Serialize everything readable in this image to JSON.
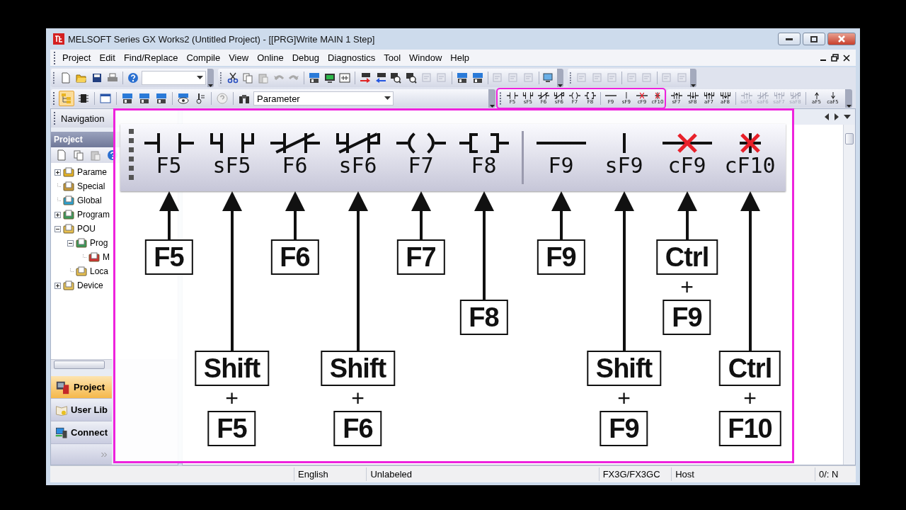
{
  "window": {
    "title": "MELSOFT Series GX Works2 (Untitled Project) - [[PRG]Write MAIN 1 Step]"
  },
  "menu": [
    "Project",
    "Edit",
    "Find/Replace",
    "Compile",
    "View",
    "Online",
    "Debug",
    "Diagnostics",
    "Tool",
    "Window",
    "Help"
  ],
  "toolbar": {
    "device_combo": {
      "value": "Parameter"
    },
    "ladder_tools": [
      {
        "kind": "contact",
        "label": "F5"
      },
      {
        "kind": "branch_contact",
        "label": "sF5"
      },
      {
        "kind": "closed_contact",
        "label": "F6"
      },
      {
        "kind": "closed_branch",
        "label": "sF6"
      },
      {
        "kind": "coil",
        "label": "F7"
      },
      {
        "kind": "instruction",
        "label": "F8"
      },
      {
        "kind": "hline",
        "label": "F9"
      },
      {
        "kind": "vline",
        "label": "sF9"
      },
      {
        "kind": "delete_hline",
        "label": "cF9"
      },
      {
        "kind": "delete_vline",
        "label": "cF10"
      }
    ],
    "extra_tools": [
      {
        "kind": "pulse_up",
        "label": "sF7",
        "disabled": false
      },
      {
        "kind": "pulse_down",
        "label": "sF8",
        "disabled": false
      },
      {
        "kind": "branch_pulse_up",
        "label": "aF7",
        "disabled": false
      },
      {
        "kind": "branch_pulse_down",
        "label": "aF8",
        "disabled": false
      },
      {
        "kind": "op_contact",
        "label": "saF5",
        "disabled": true
      },
      {
        "kind": "op_closed",
        "label": "saF6",
        "disabled": true
      },
      {
        "kind": "op_branch",
        "label": "saF7",
        "disabled": true
      },
      {
        "kind": "op_branch_closed",
        "label": "saF8",
        "disabled": true
      },
      {
        "kind": "arrow_up",
        "label": "aF5",
        "disabled": false
      },
      {
        "kind": "arrow_down",
        "label": "caF5",
        "disabled": false
      }
    ]
  },
  "navigation": {
    "title": "Navigation",
    "section": "Project",
    "tree": [
      {
        "label": "Parame",
        "expanded": false
      },
      {
        "label": "Special"
      },
      {
        "label": "Global"
      },
      {
        "label": "Program",
        "expanded": false
      },
      {
        "label": "POU",
        "expanded": true,
        "children": [
          {
            "label": "Prog",
            "expanded": true,
            "children": [
              {
                "label": "M"
              }
            ]
          },
          {
            "label": "Loca"
          }
        ]
      },
      {
        "label": "Device",
        "expanded": false
      }
    ],
    "views": [
      {
        "label": "Project",
        "selected": true
      },
      {
        "label": "User Lib",
        "selected": false
      },
      {
        "label": "Connect",
        "selected": false
      }
    ]
  },
  "callout": {
    "symbols": [
      {
        "kind": "contact",
        "label": "F5",
        "keys": [
          {
            "kind": "key",
            "text": "F5"
          }
        ]
      },
      {
        "kind": "branch_contact",
        "label": "sF5",
        "keys": [
          {
            "kind": "key",
            "text": "Shift"
          },
          {
            "kind": "plus",
            "text": "+"
          },
          {
            "kind": "key",
            "text": "F5"
          }
        ]
      },
      {
        "kind": "closed_contact",
        "label": "F6",
        "keys": [
          {
            "kind": "key",
            "text": "F6"
          }
        ]
      },
      {
        "kind": "closed_branch",
        "label": "sF6",
        "keys": [
          {
            "kind": "key",
            "text": "Shift"
          },
          {
            "kind": "plus",
            "text": "+"
          },
          {
            "kind": "key",
            "text": "F6"
          }
        ]
      },
      {
        "kind": "coil",
        "label": "F7",
        "keys": [
          {
            "kind": "key",
            "text": "F7"
          }
        ]
      },
      {
        "kind": "instruction",
        "label": "F8",
        "keys": [
          {
            "kind": "key",
            "text": "F8"
          }
        ]
      },
      {
        "kind": "hline",
        "label": "F9",
        "keys": [
          {
            "kind": "key",
            "text": "F9"
          }
        ]
      },
      {
        "kind": "vline",
        "label": "sF9",
        "keys": [
          {
            "kind": "key",
            "text": "Shift"
          },
          {
            "kind": "plus",
            "text": "+"
          },
          {
            "kind": "key",
            "text": "F9"
          }
        ]
      },
      {
        "kind": "delete_hline",
        "label": "cF9",
        "keys": [
          {
            "kind": "key",
            "text": "Ctrl"
          },
          {
            "kind": "plus",
            "text": "+"
          },
          {
            "kind": "key",
            "text": "F9"
          }
        ]
      },
      {
        "kind": "delete_vline",
        "label": "cF10",
        "keys": [
          {
            "kind": "key",
            "text": "Ctrl"
          },
          {
            "kind": "plus",
            "text": "+"
          },
          {
            "kind": "key",
            "text": "F10"
          }
        ]
      }
    ]
  },
  "status_bar": [
    "English",
    "Unlabeled",
    "FX3G/FX3GC",
    "Host",
    "0/: N"
  ]
}
